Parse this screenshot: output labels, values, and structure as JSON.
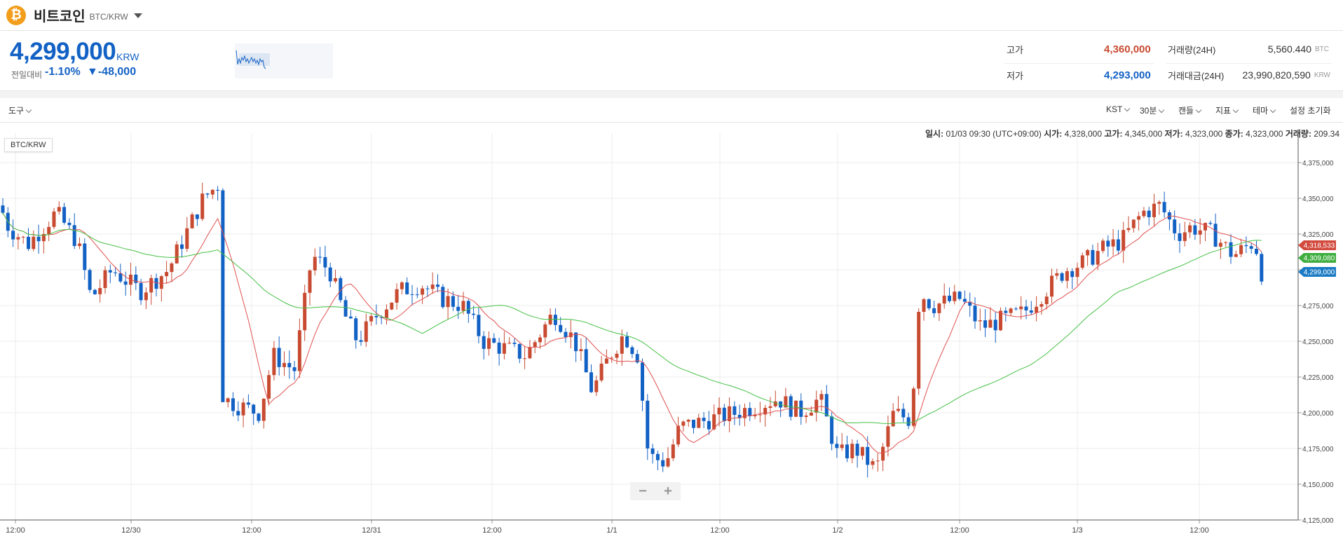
{
  "header": {
    "coin_icon": "bitcoin-icon",
    "coin_name": "비트코인",
    "pair": "BTC/KRW"
  },
  "price": {
    "current": "4,299,000",
    "unit": "KRW",
    "change_label": "전일대비",
    "change_rate": "-1.10%",
    "change_amount": "▼-48,000"
  },
  "stats": {
    "high_label": "고가",
    "high": "4,360,000",
    "low_label": "저가",
    "low": "4,293,000",
    "volume_label": "거래량(24H)",
    "volume": "5,560.440",
    "volume_unit": "BTC",
    "value_label": "거래대금(24H)",
    "value": "23,990,820,590",
    "value_unit": "KRW"
  },
  "toolbar": {
    "tools": "도구",
    "timezone": "KST",
    "interval": "30분",
    "candle": "캔들",
    "indicator": "지표",
    "theme": "테마",
    "reset": "설정 초기화"
  },
  "info": {
    "date_label": "일시:",
    "date": "01/03 09:30 (UTC+09:00)",
    "open_label": "시가:",
    "open": "4,328,000",
    "high_label": "고가:",
    "high": "4,345,000",
    "low_label": "저가:",
    "low": "4,323,000",
    "close_label": "종가:",
    "close": "4,323,000",
    "vol_label": "거래량:",
    "vol": "209.34"
  },
  "chart_badge": "BTC/KRW",
  "chart_data": {
    "type": "candlestick",
    "x_ticks": [
      "12:00",
      "12/30",
      "12:00",
      "12/31",
      "12:00",
      "1/1",
      "12:00",
      "1/2",
      "12:00",
      "1/3",
      "12:00"
    ],
    "y_ticks": [
      "4,375,000",
      "4,350,000",
      "4,325,000",
      "4,300,000",
      "4,275,000",
      "4,250,000",
      "4,225,000",
      "4,200,000",
      "4,175,000",
      "4,150,000",
      "4,125,000"
    ],
    "ylim": [
      4125000,
      4375000
    ],
    "price_tags": [
      {
        "value": "4,318,533",
        "color": "#d24a3e"
      },
      {
        "value": "4,309,080",
        "color": "#3fae3f"
      },
      {
        "value": "4,299,000",
        "color": "#1a7bc4"
      }
    ],
    "up_color": "#c84a31",
    "down_color": "#1261c4",
    "ma_short_color": "#e05050",
    "ma_long_color": "#44c044"
  },
  "zoom": {
    "minus": "−",
    "plus": "+"
  }
}
